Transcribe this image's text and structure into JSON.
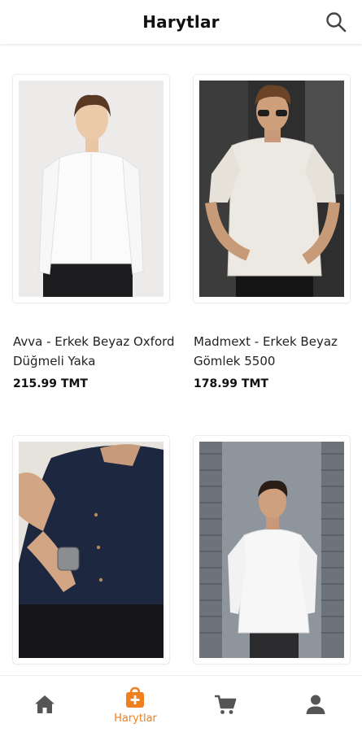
{
  "header": {
    "title": "Harytlar",
    "search_icon": "search-icon"
  },
  "products": [
    {
      "title": "Avva - Erkek Beyaz Oxford Düğmeli Yaka",
      "price": "215.99 TMT"
    },
    {
      "title": "Madmext - Erkek Beyaz Gömlek 5500",
      "price": "178.99 TMT"
    },
    {
      "title": "",
      "price": ""
    },
    {
      "title": "",
      "price": ""
    }
  ],
  "bottom_nav": {
    "items": [
      {
        "icon": "home-icon",
        "label": "",
        "active": false
      },
      {
        "icon": "shopping-bag-icon",
        "label": "Harytlar",
        "active": true
      },
      {
        "icon": "cart-icon",
        "label": "",
        "active": false
      },
      {
        "icon": "user-icon",
        "label": "",
        "active": false
      }
    ]
  },
  "colors": {
    "accent": "#f07f1d",
    "inactive_icon": "#555555",
    "text": "#111111"
  }
}
